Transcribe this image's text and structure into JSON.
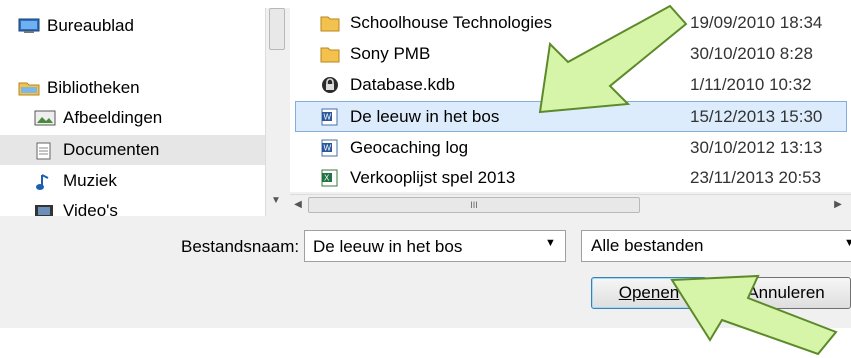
{
  "nav": {
    "items": [
      {
        "label": "Bureaublad",
        "icon": "desktop-icon"
      },
      {
        "label": "Bibliotheken",
        "icon": "libraries-icon"
      },
      {
        "label": "Afbeeldingen",
        "icon": "pictures-icon"
      },
      {
        "label": "Documenten",
        "icon": "documents-icon",
        "selected": true
      },
      {
        "label": "Muziek",
        "icon": "music-icon"
      },
      {
        "label": "Video's",
        "icon": "videos-icon"
      }
    ]
  },
  "files": [
    {
      "name": "Schoolhouse Technologies",
      "date": "19/09/2010 18:34",
      "icon": "folder-icon"
    },
    {
      "name": "Sony PMB",
      "date": "30/10/2010 8:28",
      "icon": "folder-icon"
    },
    {
      "name": "Database.kdb",
      "date": "1/11/2010 10:32",
      "icon": "lock-file-icon"
    },
    {
      "name": "De leeuw in het bos",
      "date": "15/12/2013 15:30",
      "icon": "word-doc-icon",
      "selected": true
    },
    {
      "name": "Geocaching log",
      "date": "30/10/2012 13:13",
      "icon": "word-doc-icon"
    },
    {
      "name": "Verkooplijst spel 2013",
      "date": "23/11/2013 20:53",
      "icon": "excel-icon"
    }
  ],
  "filename": {
    "label": "Bestandsnaam:",
    "value": "De leeuw in het bos"
  },
  "filter": {
    "value": "Alle bestanden"
  },
  "buttons": {
    "open": "Openen",
    "cancel": "Annuleren"
  },
  "hscroll_grip": "III",
  "colors": {
    "selection_bg": "#dcecfc",
    "selection_border": "#84acdd",
    "arrow_fill": "#d6f5a8",
    "arrow_stroke": "#5c8a2a"
  }
}
